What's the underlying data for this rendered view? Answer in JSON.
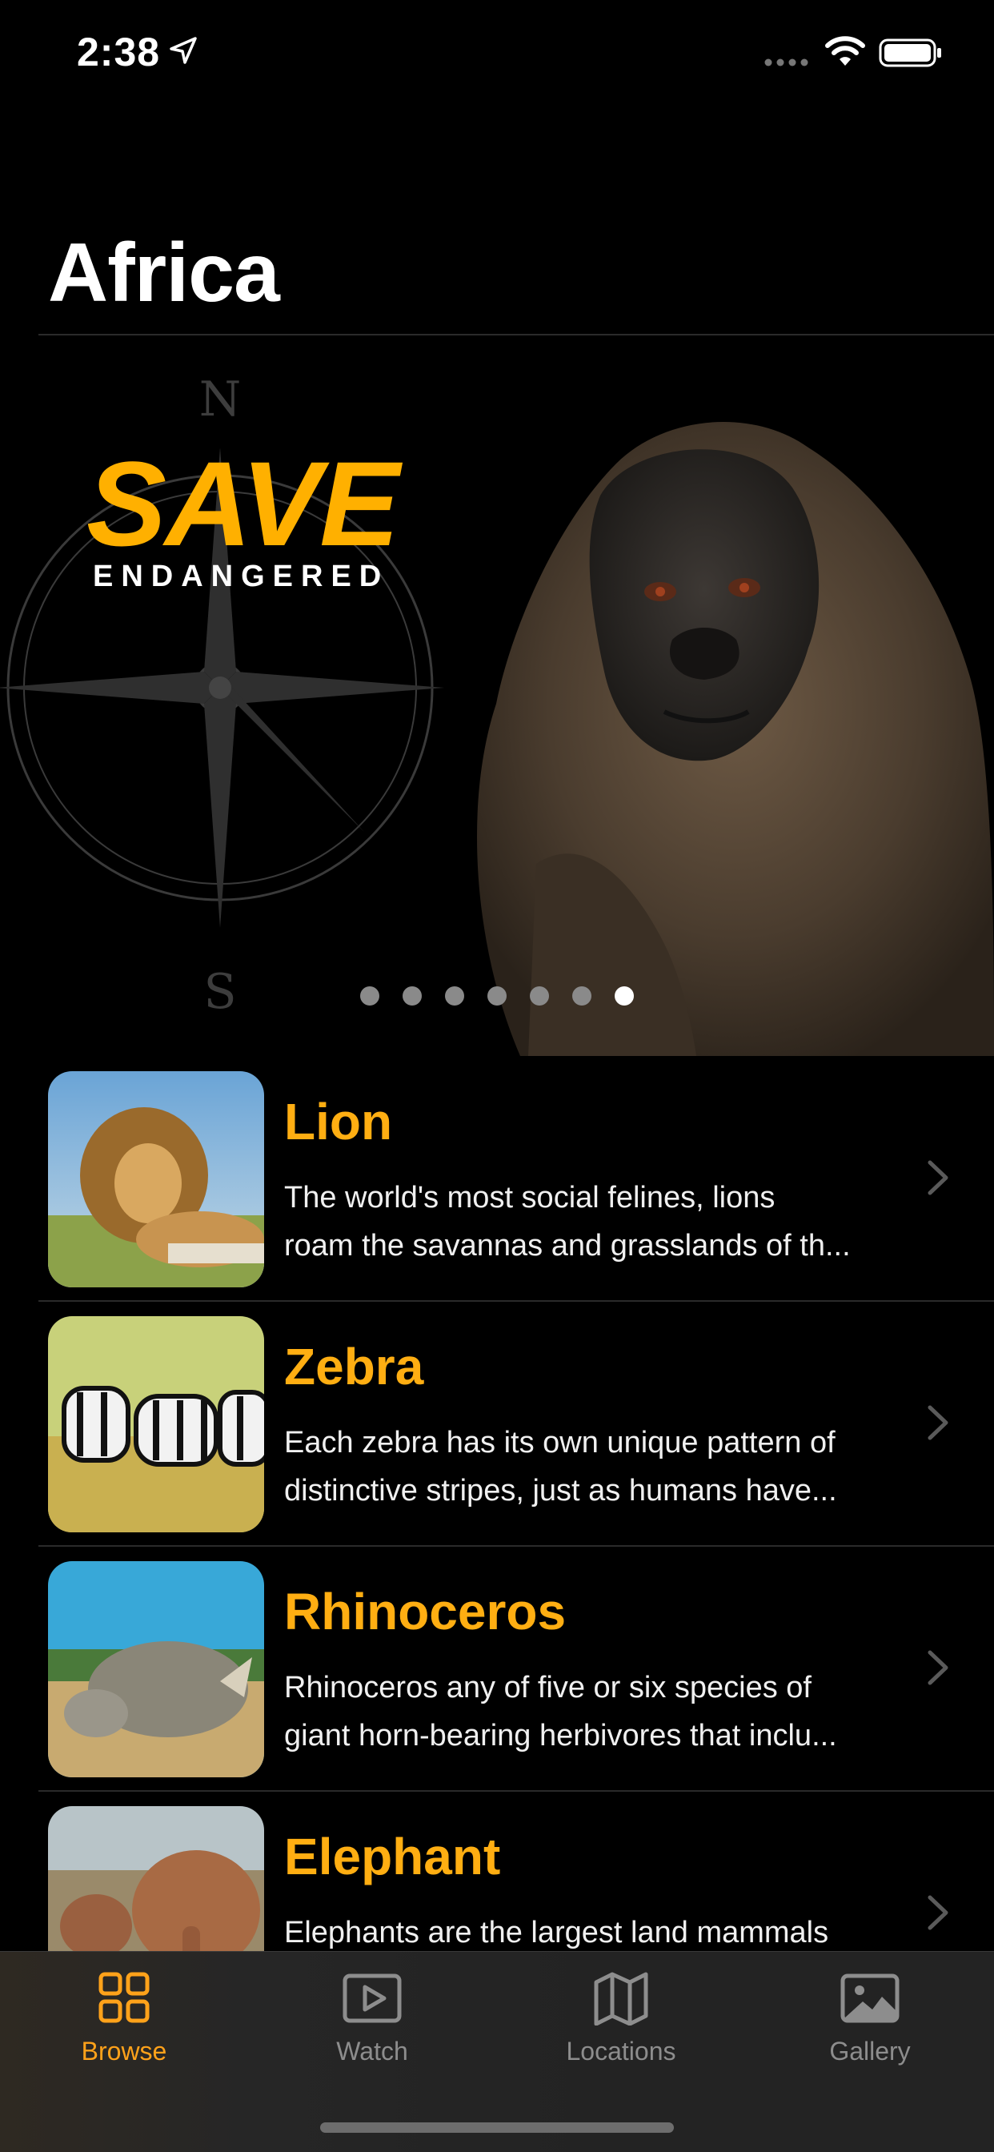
{
  "status": {
    "time": "2:38"
  },
  "page": {
    "title": "Africa"
  },
  "hero": {
    "headline": "SAVE",
    "subheadline": "ENDANGERED",
    "compass_north": "N",
    "compass_south": "S",
    "page_count": 7,
    "active_page": 7
  },
  "animals": [
    {
      "name": "Lion",
      "desc_line1": "The world's most social felines, lions",
      "desc_line2": "roam the savannas and grasslands of th..."
    },
    {
      "name": "Zebra",
      "desc_line1": "Each zebra has its own unique pattern of",
      "desc_line2": "distinctive stripes, just as humans have..."
    },
    {
      "name": "Rhinoceros",
      "desc_line1": "Rhinoceros any of five or six species of",
      "desc_line2": "giant horn-bearing herbivores that inclu..."
    },
    {
      "name": "Elephant",
      "desc_line1": "Elephants are the largest land mammals",
      "desc_line2": ""
    }
  ],
  "tabs": [
    {
      "label": "Browse",
      "icon": "grid-icon",
      "active": true
    },
    {
      "label": "Watch",
      "icon": "play-icon",
      "active": false
    },
    {
      "label": "Locations",
      "icon": "map-icon",
      "active": false
    },
    {
      "label": "Gallery",
      "icon": "photo-icon",
      "active": false
    }
  ],
  "colors": {
    "accent": "#ffae12",
    "background": "#000000",
    "tab_inactive": "#8d8d8d"
  }
}
